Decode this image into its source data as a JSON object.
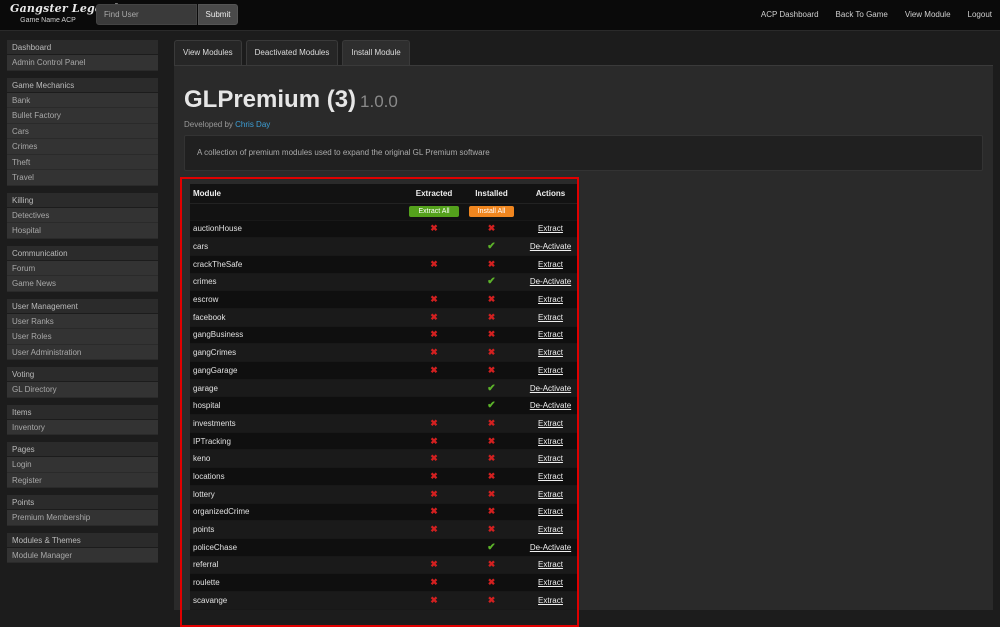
{
  "brand": {
    "title": "Gangster Legends",
    "subtitle": "Game Name ACP"
  },
  "search": {
    "placeholder": "Find User",
    "value": "",
    "submit_label": "Submit"
  },
  "topnav": [
    "ACP Dashboard",
    "Back To Game",
    "View Module",
    "Logout"
  ],
  "sidebar": [
    {
      "heading": "Dashboard",
      "items": [
        "Admin Control Panel"
      ]
    },
    {
      "heading": "Game Mechanics",
      "items": [
        "Bank",
        "Bullet Factory",
        "Cars",
        "Crimes",
        "Theft",
        "Travel"
      ]
    },
    {
      "heading": "Killing",
      "items": [
        "Detectives",
        "Hospital"
      ]
    },
    {
      "heading": "Communication",
      "items": [
        "Forum",
        "Game News"
      ]
    },
    {
      "heading": "User Management",
      "items": [
        "User Ranks",
        "User Roles",
        "User Administration"
      ]
    },
    {
      "heading": "Voting",
      "items": [
        "GL Directory"
      ]
    },
    {
      "heading": "Items",
      "items": [
        "Inventory"
      ]
    },
    {
      "heading": "Pages",
      "items": [
        "Login",
        "Register"
      ]
    },
    {
      "heading": "Points",
      "items": [
        "Premium Membership"
      ]
    },
    {
      "heading": "Modules & Themes",
      "items": [
        "Module Manager"
      ]
    }
  ],
  "tabs": [
    "View Modules",
    "Deactivated Modules",
    "Install Module"
  ],
  "module": {
    "name": "GLPremium (3)",
    "version": "1.0.0",
    "developed_by_label": "Developed by",
    "developer": "Chris Day",
    "description": "A collection of premium modules used to expand the original GL Premium software"
  },
  "table": {
    "headers": [
      "Module",
      "Extracted",
      "Installed",
      "Actions"
    ],
    "extract_all_label": "Extract All",
    "install_all_label": "Install All",
    "rows": [
      {
        "module": "auctionHouse",
        "extracted": "x",
        "installed": "x",
        "action": "Extract"
      },
      {
        "module": "cars",
        "extracted": "",
        "installed": "check",
        "action": "De-Activate"
      },
      {
        "module": "crackTheSafe",
        "extracted": "x",
        "installed": "x",
        "action": "Extract"
      },
      {
        "module": "crimes",
        "extracted": "",
        "installed": "check",
        "action": "De-Activate"
      },
      {
        "module": "escrow",
        "extracted": "x",
        "installed": "x",
        "action": "Extract"
      },
      {
        "module": "facebook",
        "extracted": "x",
        "installed": "x",
        "action": "Extract"
      },
      {
        "module": "gangBusiness",
        "extracted": "x",
        "installed": "x",
        "action": "Extract"
      },
      {
        "module": "gangCrimes",
        "extracted": "x",
        "installed": "x",
        "action": "Extract"
      },
      {
        "module": "gangGarage",
        "extracted": "x",
        "installed": "x",
        "action": "Extract"
      },
      {
        "module": "garage",
        "extracted": "",
        "installed": "check",
        "action": "De-Activate"
      },
      {
        "module": "hospital",
        "extracted": "",
        "installed": "check",
        "action": "De-Activate"
      },
      {
        "module": "investments",
        "extracted": "x",
        "installed": "x",
        "action": "Extract"
      },
      {
        "module": "IPTracking",
        "extracted": "x",
        "installed": "x",
        "action": "Extract"
      },
      {
        "module": "keno",
        "extracted": "x",
        "installed": "x",
        "action": "Extract"
      },
      {
        "module": "locations",
        "extracted": "x",
        "installed": "x",
        "action": "Extract"
      },
      {
        "module": "lottery",
        "extracted": "x",
        "installed": "x",
        "action": "Extract"
      },
      {
        "module": "organizedCrime",
        "extracted": "x",
        "installed": "x",
        "action": "Extract"
      },
      {
        "module": "points",
        "extracted": "x",
        "installed": "x",
        "action": "Extract"
      },
      {
        "module": "policeChase",
        "extracted": "",
        "installed": "check",
        "action": "De-Activate"
      },
      {
        "module": "referral",
        "extracted": "x",
        "installed": "x",
        "action": "Extract"
      },
      {
        "module": "roulette",
        "extracted": "x",
        "installed": "x",
        "action": "Extract"
      },
      {
        "module": "scavange",
        "extracted": "x",
        "installed": "x",
        "action": "Extract"
      }
    ]
  },
  "colors": {
    "highlight_border": "#e00000",
    "link": "#3d9fd6",
    "extract_all": "#54a11c",
    "install_all": "#f0861f",
    "cross": "#d32020",
    "check": "#5cb32a"
  },
  "icons": {
    "cross": "cross-icon",
    "check": "check-icon"
  }
}
